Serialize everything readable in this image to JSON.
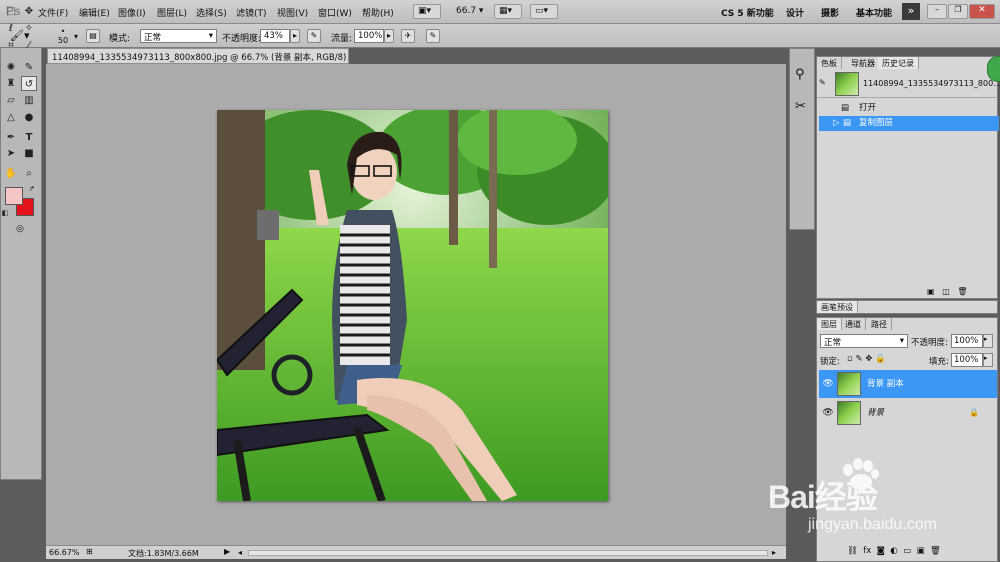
{
  "app": {
    "logo": "Ps"
  },
  "menu": [
    "文件(F)",
    "编辑(E)",
    "图像(I)",
    "图层(L)",
    "选择(S)",
    "滤镜(T)",
    "视图(V)",
    "窗口(W)",
    "帮助(H)"
  ],
  "zoom_menu": "66.7",
  "workspaces": [
    "CS 5 新功能",
    "设计",
    "摄影",
    "基本功能"
  ],
  "options": {
    "brush_size": "50",
    "mode_label": "模式:",
    "mode_value": "正常",
    "opacity_label": "不透明度:",
    "opacity_value": "43%",
    "flow_label": "流量:",
    "flow_value": "100%"
  },
  "document": {
    "tab_title": "11408994_1335534973113_800x800.jpg @ 66.7% (背景 副本, RGB/8) *",
    "close": "✕"
  },
  "status": {
    "zoom": "66.67%",
    "doc_size": "文档:1.83M/3.66M"
  },
  "history_panel": {
    "tabs": [
      "色板",
      "导航器",
      "历史记录"
    ],
    "snapshot_name": "11408994_1335534973113_800...",
    "items": [
      {
        "label": "打开",
        "selected": false
      },
      {
        "label": "复制图层",
        "selected": true
      }
    ]
  },
  "brush_presets_tab": "画笔预设",
  "layers_panel": {
    "tabs": [
      "图层",
      "通道",
      "路径"
    ],
    "blend_mode": "正常",
    "opacity_label": "不透明度:",
    "opacity_value": "100%",
    "lock_label": "锁定:",
    "fill_label": "填充:",
    "fill_value": "100%",
    "layers": [
      {
        "name": "背景 副本",
        "selected": true,
        "locked": false
      },
      {
        "name": "背景",
        "selected": false,
        "locked": true
      }
    ]
  },
  "watermark": {
    "brand": "Bai经验",
    "url": "jingyan.baidu.com"
  },
  "colors": {
    "foreground": "#f4c6c6",
    "background": "#e3121b",
    "selection": "#3b97f3"
  }
}
